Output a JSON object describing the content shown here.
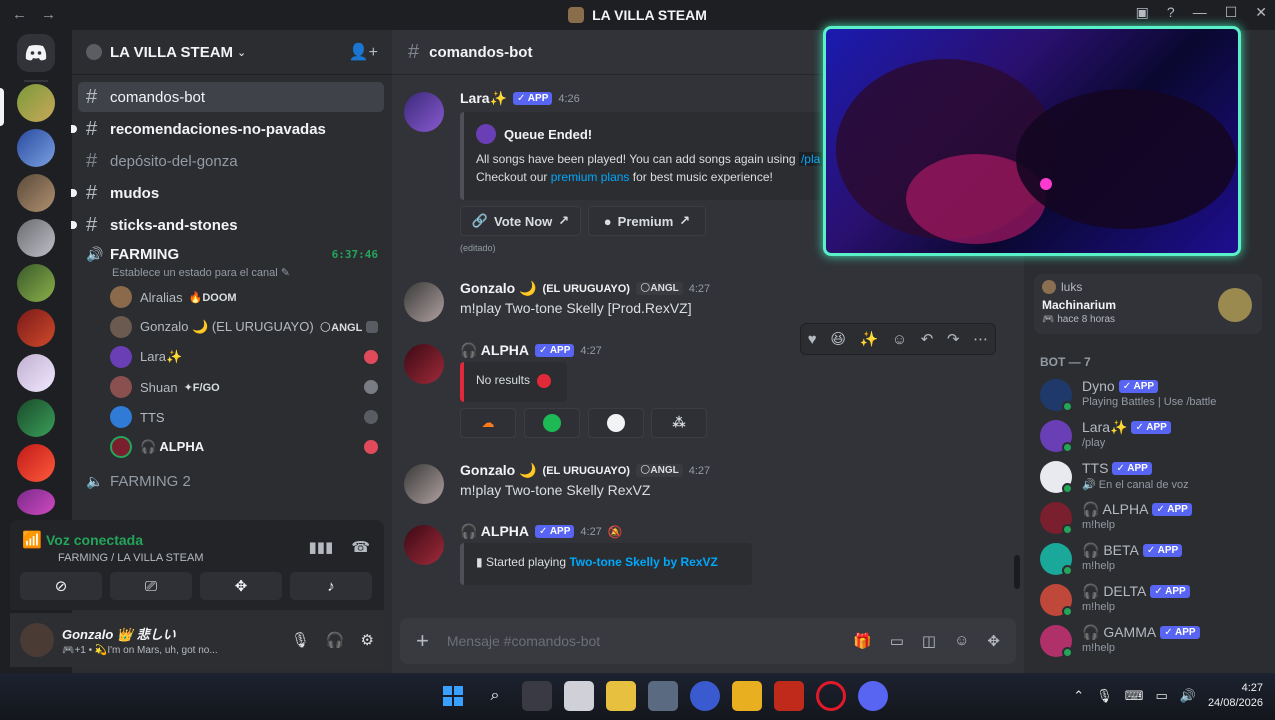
{
  "window": {
    "title": "LA VILLA STEAM",
    "back": "←",
    "forward": "→",
    "controls": [
      "▣",
      "?",
      "—",
      "☐",
      "✕"
    ]
  },
  "server": {
    "name": "LA VILLA STEAM",
    "chevron": "⌄",
    "invite_icon": "👤+"
  },
  "channels": [
    {
      "name": "comandos-bot",
      "active": true,
      "unread": false
    },
    {
      "name": "recomendaciones-no-pavadas",
      "active": false,
      "unread": true
    },
    {
      "name": "depósito-del-gonza",
      "active": false,
      "unread": false
    },
    {
      "name": "mudos",
      "active": false,
      "unread": true
    },
    {
      "name": "sticks-and-stones",
      "active": false,
      "unread": true
    }
  ],
  "voice_channel": {
    "name": "FARMING",
    "timer": "6:37:46",
    "status_placeholder": "Establece un estado para el canal",
    "users": [
      {
        "name": "Alralias",
        "tag": "🔥DOOM"
      },
      {
        "name": "Gonzalo 🌙 (EL URUGUAYO)",
        "tag": "🌕ANGL"
      },
      {
        "name": "Lara✨",
        "tag": ""
      },
      {
        "name": "Shuan",
        "tag": "✦F/GO"
      },
      {
        "name": "TTS",
        "tag": ""
      },
      {
        "name": "🎧 ALPHA",
        "tag": ""
      }
    ]
  },
  "voice_channel2": {
    "name": "FARMING 2"
  },
  "voice_panel": {
    "title": "Voz conectada",
    "subtitle": "FARMING / LA VILLA STEAM"
  },
  "user_panel": {
    "name": "Gonzalo 👑 悲しい",
    "status": "🎮+1 • 💫I'm on Mars, uh, got no..."
  },
  "chat": {
    "channel": "comandos-bot",
    "messages": {
      "lara": {
        "author": "Lara✨",
        "app": "✓ APP",
        "time": "4:26",
        "embed_title": "Queue Ended!",
        "embed_line1": "All songs have been played! You can add songs again using",
        "embed_cmd": "/pla",
        "embed_line2_a": "Checkout our",
        "embed_link": "premium plans",
        "embed_line2_b": "for best music experience!",
        "btn_vote": "Vote Now",
        "btn_premium": "Premium",
        "edited": "(editado)"
      },
      "gonzalo1": {
        "author": "Gonzalo 🌙",
        "suffix": "(EL URUGUAYO)",
        "tag": "🌕ANGL",
        "time": "4:27",
        "text": "m!play Two-tone Skelly [Prod.RexVZ]"
      },
      "alpha1": {
        "author": "🎧 ALPHA",
        "app": "✓ APP",
        "time": "4:27",
        "embed_text": "No results"
      },
      "gonzalo2": {
        "author": "Gonzalo 🌙",
        "suffix": "(EL URUGUAYO)",
        "tag": "🌕ANGL",
        "time": "4:27",
        "text": "m!play Two-tone Skelly RexVZ"
      },
      "alpha2": {
        "author": "🎧 ALPHA",
        "app": "✓ APP",
        "time": "4:27",
        "embed_prefix": "Started playing",
        "embed_link": "Two-tone Skelly by RexVZ"
      }
    },
    "composer_placeholder": "Mensaje #comandos-bot"
  },
  "members": {
    "activity": {
      "user": "luks",
      "game": "Machinarium",
      "ago": "hace 8 horas"
    },
    "bot_label": "BOT — 7",
    "bots": [
      {
        "name": "Dyno",
        "status": "Playing Battles | Use /battle",
        "color": "#3b82f6"
      },
      {
        "name": "Lara✨",
        "status": "/play",
        "color": "#6a3fb5"
      },
      {
        "name": "TTS",
        "status": "🔊 En el canal de voz",
        "color": "#2f7bd6"
      },
      {
        "name": "🎧 ALPHA",
        "status": "m!help",
        "color": "#7a1f2e"
      },
      {
        "name": "🎧 BETA",
        "status": "m!help",
        "color": "#1aa89a"
      },
      {
        "name": "🎧 DELTA",
        "status": "m!help",
        "color": "#c0483a"
      },
      {
        "name": "🎧 GAMMA",
        "status": "m!help",
        "color": "#b0306a"
      }
    ],
    "app_label": "✓ APP"
  },
  "taskbar": {
    "time": "4:27",
    "date": "24/08/2026"
  }
}
